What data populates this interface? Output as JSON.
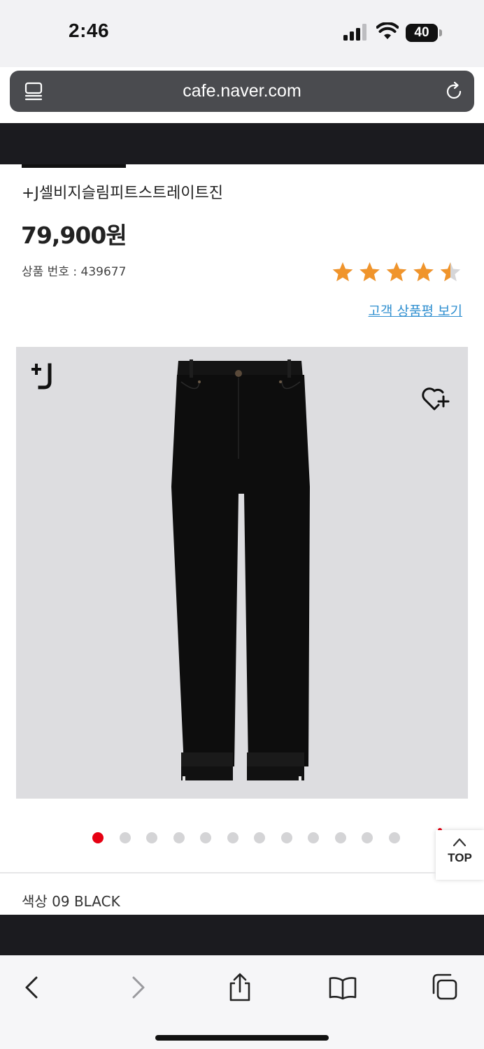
{
  "status_bar": {
    "time": "2:46",
    "battery": "40",
    "icons": [
      "signal-icon",
      "wifi-icon",
      "battery-icon"
    ]
  },
  "browser": {
    "url": "cafe.naver.com",
    "icons": [
      "tabs-icon",
      "reload-icon"
    ]
  },
  "product": {
    "name": "+J셀비지슬림피트스트레이트진",
    "price": "79,900원",
    "number": "상품 번호 : 439677",
    "rating": 4.5,
    "rating_max": 5,
    "review_link": "고객 상품평 보기",
    "star_color": "#f0942b"
  },
  "gallery": {
    "brand_icon": "plus-j-logo",
    "wishlist_icon": "heart-plus-icon",
    "dot_count": 12,
    "active_dot": 0,
    "active_color": "#e60012"
  },
  "top_button": {
    "label": "TOP"
  },
  "color_option": {
    "label": "색상 09 BLACK"
  },
  "toolbar": {
    "icons": [
      "back-icon",
      "forward-icon",
      "share-icon",
      "bookmarks-icon",
      "tabs-overview-icon"
    ]
  }
}
